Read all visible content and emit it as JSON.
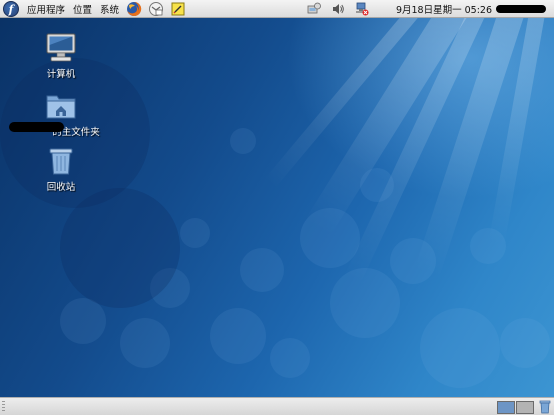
{
  "top_panel": {
    "menus": [
      "应用程序",
      "位置",
      "系统"
    ],
    "clock": "9月18日星期一 05:26"
  },
  "desktop": {
    "icons": [
      {
        "label": "计算机",
        "icon": "computer-icon"
      },
      {
        "label": "的主文件夹",
        "icon": "home-folder-icon"
      },
      {
        "label": "回收站",
        "icon": "trash-icon"
      }
    ]
  },
  "bottom_panel": {
    "workspaces": 2,
    "active_workspace": 1
  },
  "colors": {
    "panel": "#e6e6e6",
    "desktop_dark": "#0a3266",
    "desktop_light": "#3c95d2",
    "workspace_active": "#6d95c5"
  }
}
